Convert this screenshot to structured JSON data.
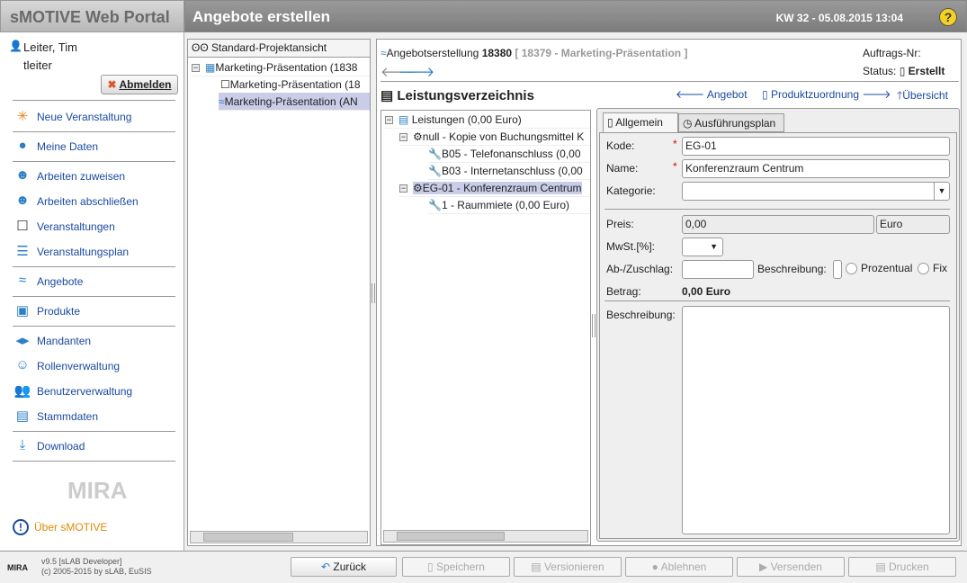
{
  "header": {
    "app_title": "sMOTIVE Web Portal",
    "page_title": "Angebote erstellen",
    "datetime": "KW 32 - 05.08.2015 13:04",
    "help": "?"
  },
  "user": {
    "name": "Leiter, Tim",
    "login": "tleiter",
    "logout": "Abmelden"
  },
  "menu": [
    "Neue Veranstaltung",
    "Meine Daten",
    "Arbeiten zuweisen",
    "Arbeiten abschließen",
    "Veranstaltungen",
    "Veranstaltungsplan",
    "Angebote",
    "Produkte",
    "Mandanten",
    "Rollenverwaltung",
    "Benutzerverwaltung",
    "Stammdaten",
    "Download"
  ],
  "about": "Über sMOTIVE",
  "logo": "MIRA",
  "project_tree": {
    "title": "Standard-Projektansicht",
    "items": [
      "Marketing-Präsentation (1838",
      "Marketing-Präsentation (18",
      "Marketing-Präsentation (AN"
    ]
  },
  "offer": {
    "label": "Angebotserstellung",
    "number": "18380",
    "ref": "[ 18379 - Marketing-Präsentation ]",
    "order_no_label": "Auftrags-Nr:",
    "status_label": "Status:",
    "status": "Erstellt"
  },
  "section": {
    "title": "Leistungsverzeichnis",
    "nav": [
      "Angebot",
      "Produktzuordnung",
      "Übersicht"
    ]
  },
  "services_tree": [
    "Leistungen (0,00 Euro)",
    "null - Kopie von Buchungsmittel K",
    "B05 - Telefonanschluss (0,00",
    "B03 - Internetanschluss (0,00",
    "EG-01 - Konferenzraum Centrum",
    "1 - Raummiete (0,00 Euro)"
  ],
  "tabs": [
    "Allgemein",
    "Ausführungsplan"
  ],
  "form": {
    "kode_label": "Kode:",
    "kode": "EG-01",
    "name_label": "Name:",
    "name": "Konferenzraum Centrum",
    "kategorie_label": "Kategorie:",
    "kategorie": "",
    "preis_label": "Preis:",
    "preis": "0,00",
    "currency": "Euro",
    "mwst_label": "MwSt.[%]:",
    "zuschlag_label": "Ab-/Zuschlag:",
    "beschreibung_short_label": "Beschreibung:",
    "prozentual": "Prozentual",
    "fix": "Fix",
    "betrag_label": "Betrag:",
    "betrag": "0,00 Euro",
    "beschreibung_label": "Beschreibung:"
  },
  "footer": {
    "version": "v9.5 [sLAB Developer]",
    "copyright": "(c) 2005-2015 by sLAB, EuSIS",
    "buttons": [
      "Zurück",
      "Speichern",
      "Versionieren",
      "Ablehnen",
      "Versenden",
      "Drucken"
    ]
  }
}
